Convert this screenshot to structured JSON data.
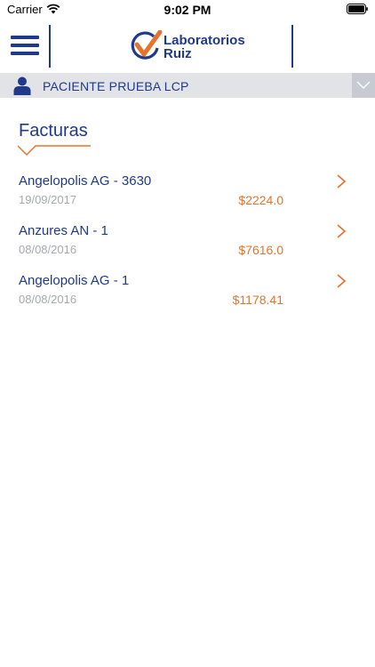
{
  "status_bar": {
    "carrier": "Carrier",
    "time": "9:02 PM"
  },
  "header": {
    "logo_line1": "Laboratorios",
    "logo_line2": "Ruiz"
  },
  "patient": {
    "name": "PACIENTE PRUEBA LCP"
  },
  "page": {
    "title": "Facturas"
  },
  "invoices": [
    {
      "name": "Angelopolis AG - 3630",
      "date": "19/09/2017",
      "amount": "$2224.0"
    },
    {
      "name": "Anzures AN - 1",
      "date": "08/08/2016",
      "amount": "$7616.0"
    },
    {
      "name": "Angelopolis AG - 1",
      "date": "08/08/2016",
      "amount": "$1178.41"
    }
  ],
  "colors": {
    "brand_blue": "#1f3a8a",
    "accent_orange": "#e8722a",
    "date_gray": "#a6a9ae",
    "patient_bar_bg": "#e1e3e7"
  },
  "icons": {
    "menu": "hamburger-icon",
    "user": "user-icon",
    "dropdown": "chevron-down-icon",
    "row": "chevron-right-icon"
  }
}
